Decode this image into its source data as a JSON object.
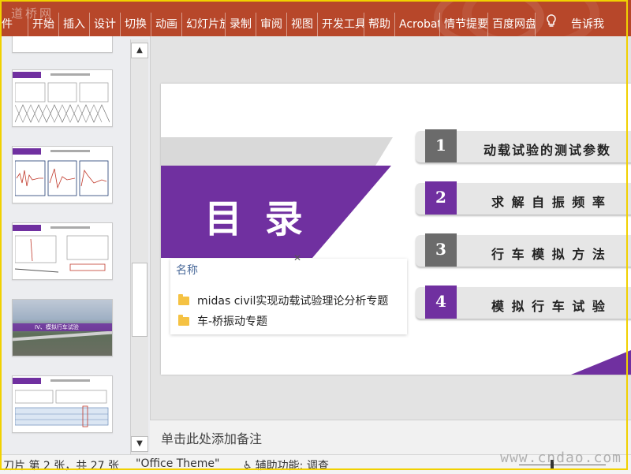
{
  "watermark_top": "道桥网",
  "watermark_bottom": "www.cndao.com",
  "ribbon": {
    "tabs": [
      "件",
      "开始",
      "插入",
      "设计",
      "切换",
      "动画",
      "幻灯片放",
      "录制",
      "审阅",
      "视图",
      "开发工具",
      "帮助",
      "Acrobat",
      "情节提要",
      "百度网盘",
      "告诉我"
    ],
    "bulb_icon": "lightbulb-icon"
  },
  "slide": {
    "title": "目 录",
    "items": [
      {
        "num": "1",
        "text": "动载试验的测试参数",
        "num_color": "#6b6b6b"
      },
      {
        "num": "2",
        "text": "求 解 自 振 频 率",
        "num_color": "#7030a0"
      },
      {
        "num": "3",
        "text": "行 车 模 拟 方 法",
        "num_color": "#6b6b6b"
      },
      {
        "num": "4",
        "text": "模 拟 行 车 试 验",
        "num_color": "#7030a0"
      }
    ],
    "thumb_photo_text": "IV、模拟行车试验"
  },
  "popup": {
    "header": "名称",
    "close_icon": "close-icon",
    "items": [
      "midas civil实现动载试验理论分析专题",
      "车-桥振动专题"
    ]
  },
  "notes_placeholder": "单击此处添加备注",
  "status": {
    "slide_info": "刀片 第 2 张，共 27 张",
    "theme": "\"Office Theme\"",
    "accessibility": "辅助功能: 调查"
  },
  "colors": {
    "ribbon": "#b7472a",
    "accent": "#7030a0",
    "gray": "#6b6b6b"
  }
}
